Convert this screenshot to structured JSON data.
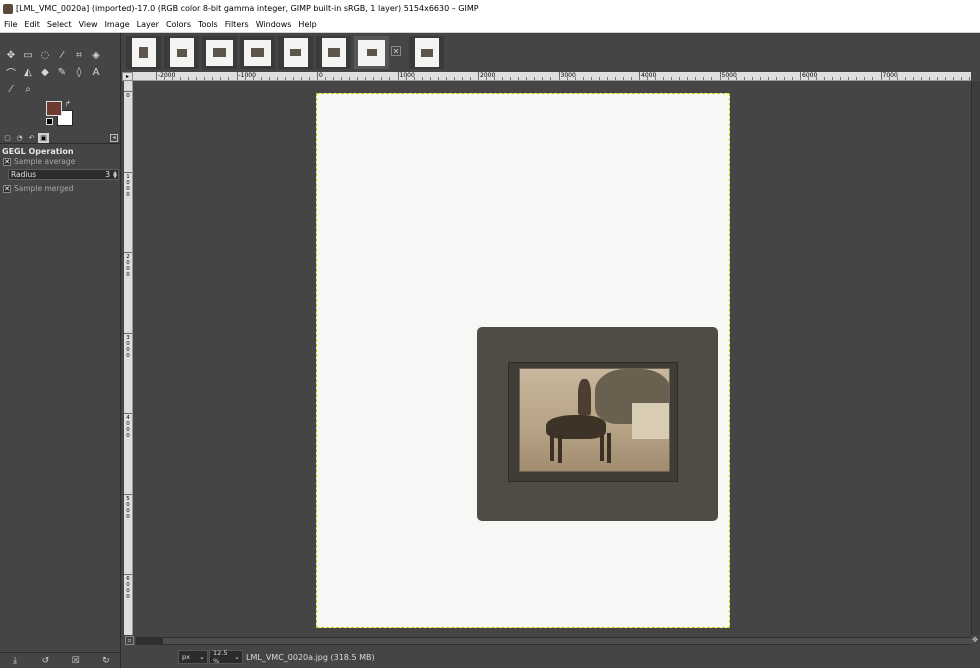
{
  "window": {
    "title": "[LML_VMC_0020a] (imported)-17.0 (RGB color 8-bit gamma integer, GIMP built-in sRGB, 1 layer) 5154x6630 – GIMP"
  },
  "menu": [
    "File",
    "Edit",
    "Select",
    "View",
    "Image",
    "Layer",
    "Colors",
    "Tools",
    "Filters",
    "Windows",
    "Help"
  ],
  "colors": {
    "foreground": "#6e3b30",
    "background": "#ffffff"
  },
  "tool_options": {
    "title": "GEGL Operation",
    "sample_average_label": "Sample average",
    "sample_average_checked": true,
    "radius_label": "Radius",
    "radius_value": "3",
    "sample_merged_label": "Sample merged",
    "sample_merged_checked": true
  },
  "ruler": {
    "top_labels": [
      "-2000",
      "-1000",
      "0",
      "1000",
      "2000",
      "3000",
      "4000",
      "5000",
      "6000",
      "7000"
    ],
    "left_labels": [
      "0",
      "1000",
      "2000",
      "3000",
      "4000",
      "5000",
      "6000"
    ]
  },
  "statusbar": {
    "unit": "px",
    "zoom": "12.5 %",
    "text": "LML_VMC_0020a.jpg (318.5 MB)"
  }
}
